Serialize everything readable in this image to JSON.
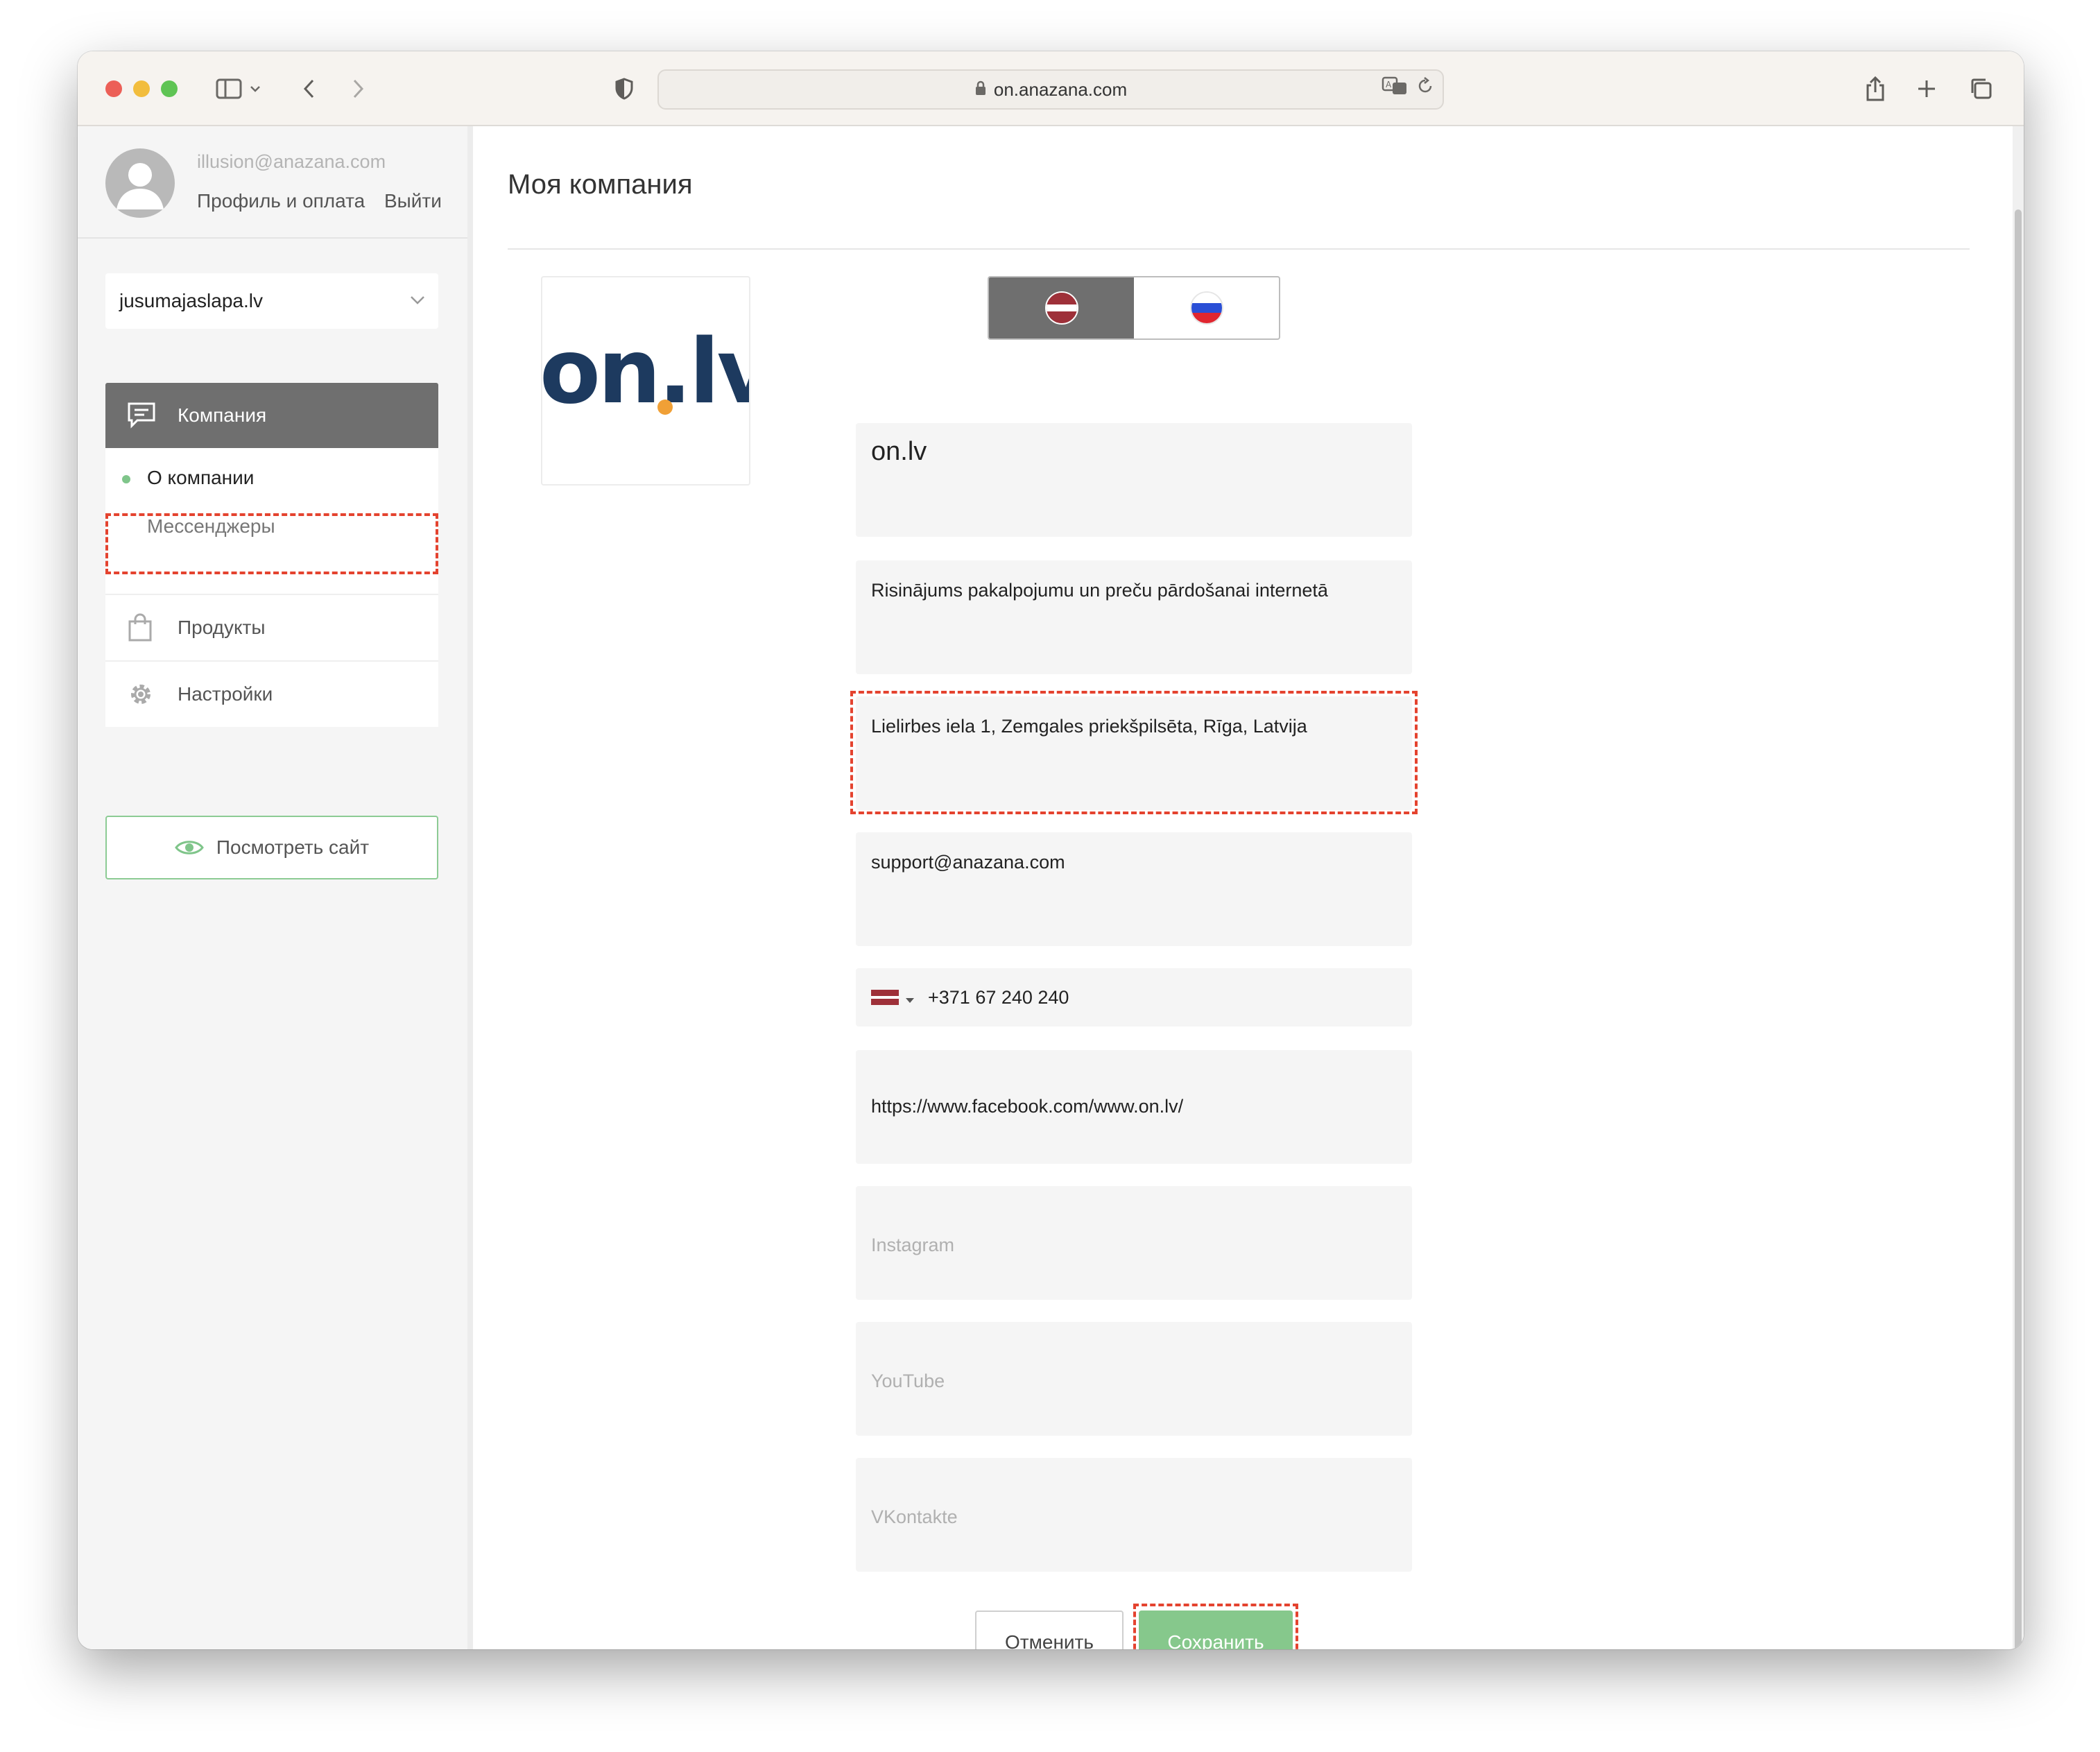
{
  "browser": {
    "url": "on.anazana.com"
  },
  "user": {
    "email": "illusion@anazana.com",
    "profile_link": "Профиль и оплата",
    "logout_link": "Выйти"
  },
  "site_selector": {
    "value": "jusumajaslapa.lv"
  },
  "sidebar": {
    "active_section": "Компания",
    "subitems": [
      "О компании",
      "Мессенджеры"
    ],
    "items": [
      "Продукты",
      "Настройки"
    ],
    "view_site": "Посмотреть сайт"
  },
  "page": {
    "title": "Моя компания"
  },
  "languages": {
    "selected": "lv",
    "options": [
      "lv",
      "ru"
    ]
  },
  "form": {
    "name": "on.lv",
    "slogan": "Risinājums pakalpojumu un preču pārdošanai internetā",
    "address": "Lielirbes iela 1, Zemgales priekšpilsēta, Rīga, Latvija",
    "email": "support@anazana.com",
    "phone": "+371 67 240 240",
    "facebook": "https://www.facebook.com/www.on.lv/",
    "instagram_placeholder": "Instagram",
    "youtube_placeholder": "YouTube",
    "vkontakte_placeholder": "VKontakte"
  },
  "logo": {
    "text": "on.lv"
  },
  "buttons": {
    "cancel": "Отменить",
    "save": "Сохранить"
  },
  "colors": {
    "accent_green": "#86c88c",
    "active_menu": "#6f6f6f",
    "highlight": "#e4432f",
    "logo_navy": "#1d3a5f",
    "logo_dot": "#f0a036"
  }
}
